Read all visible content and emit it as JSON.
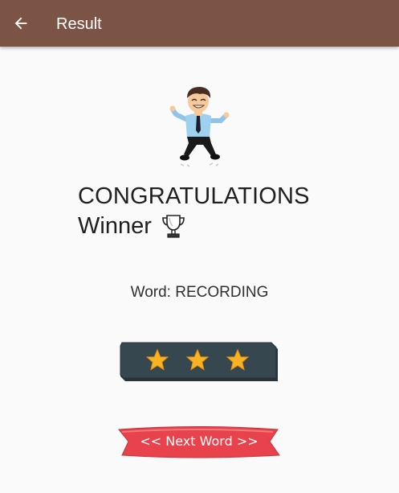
{
  "appbar": {
    "title": "Result",
    "back_icon": "arrow-back-icon",
    "color": "#7b5446"
  },
  "result": {
    "headline": "CONGRATULATIONS",
    "subheadline": "Winner",
    "trophy_icon": "trophy-icon",
    "word_label": "Word: RECORDING"
  },
  "rating": {
    "stars_earned": 3,
    "stars_total": 3,
    "star_color": "#f9b322",
    "board_color": "#37474f"
  },
  "next_button": {
    "label": "<< Next Word >>",
    "color": "#e8434c"
  }
}
